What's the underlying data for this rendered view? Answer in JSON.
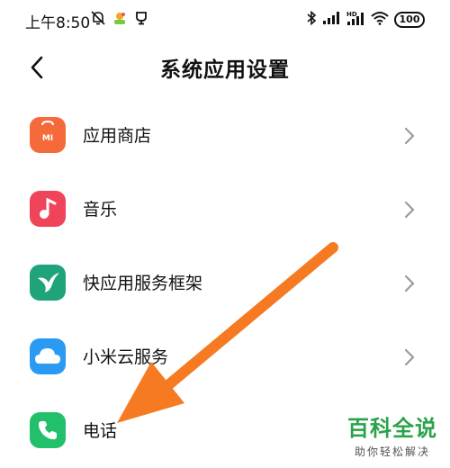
{
  "status_bar": {
    "time": "上午8:50",
    "battery": "100",
    "icons_left": [
      "mute-bell-icon",
      "app-badge-icon",
      "trophy-icon"
    ],
    "icons_right": [
      "bluetooth-icon",
      "signal-icon",
      "hd-signal-icon",
      "wifi-icon",
      "battery-icon"
    ]
  },
  "header": {
    "title": "系统应用设置",
    "back_icon": "chevron-left-icon"
  },
  "items": [
    {
      "label": "应用商店",
      "icon": "app-store-icon",
      "icon_text": "MI",
      "color": "#f56a3a"
    },
    {
      "label": "音乐",
      "icon": "music-icon",
      "color": "#f0445a"
    },
    {
      "label": "快应用服务框架",
      "icon": "quick-app-icon",
      "color": "#1fa37a"
    },
    {
      "label": "小米云服务",
      "icon": "cloud-icon",
      "color": "#2b9af3"
    },
    {
      "label": "电话",
      "icon": "phone-icon",
      "color": "#22c06a"
    }
  ],
  "watermark": {
    "main": "百科全说",
    "sub": "助你轻松解决"
  },
  "colors": {
    "arrow": "#f57a22",
    "watermark_green": "#2aa24a"
  }
}
